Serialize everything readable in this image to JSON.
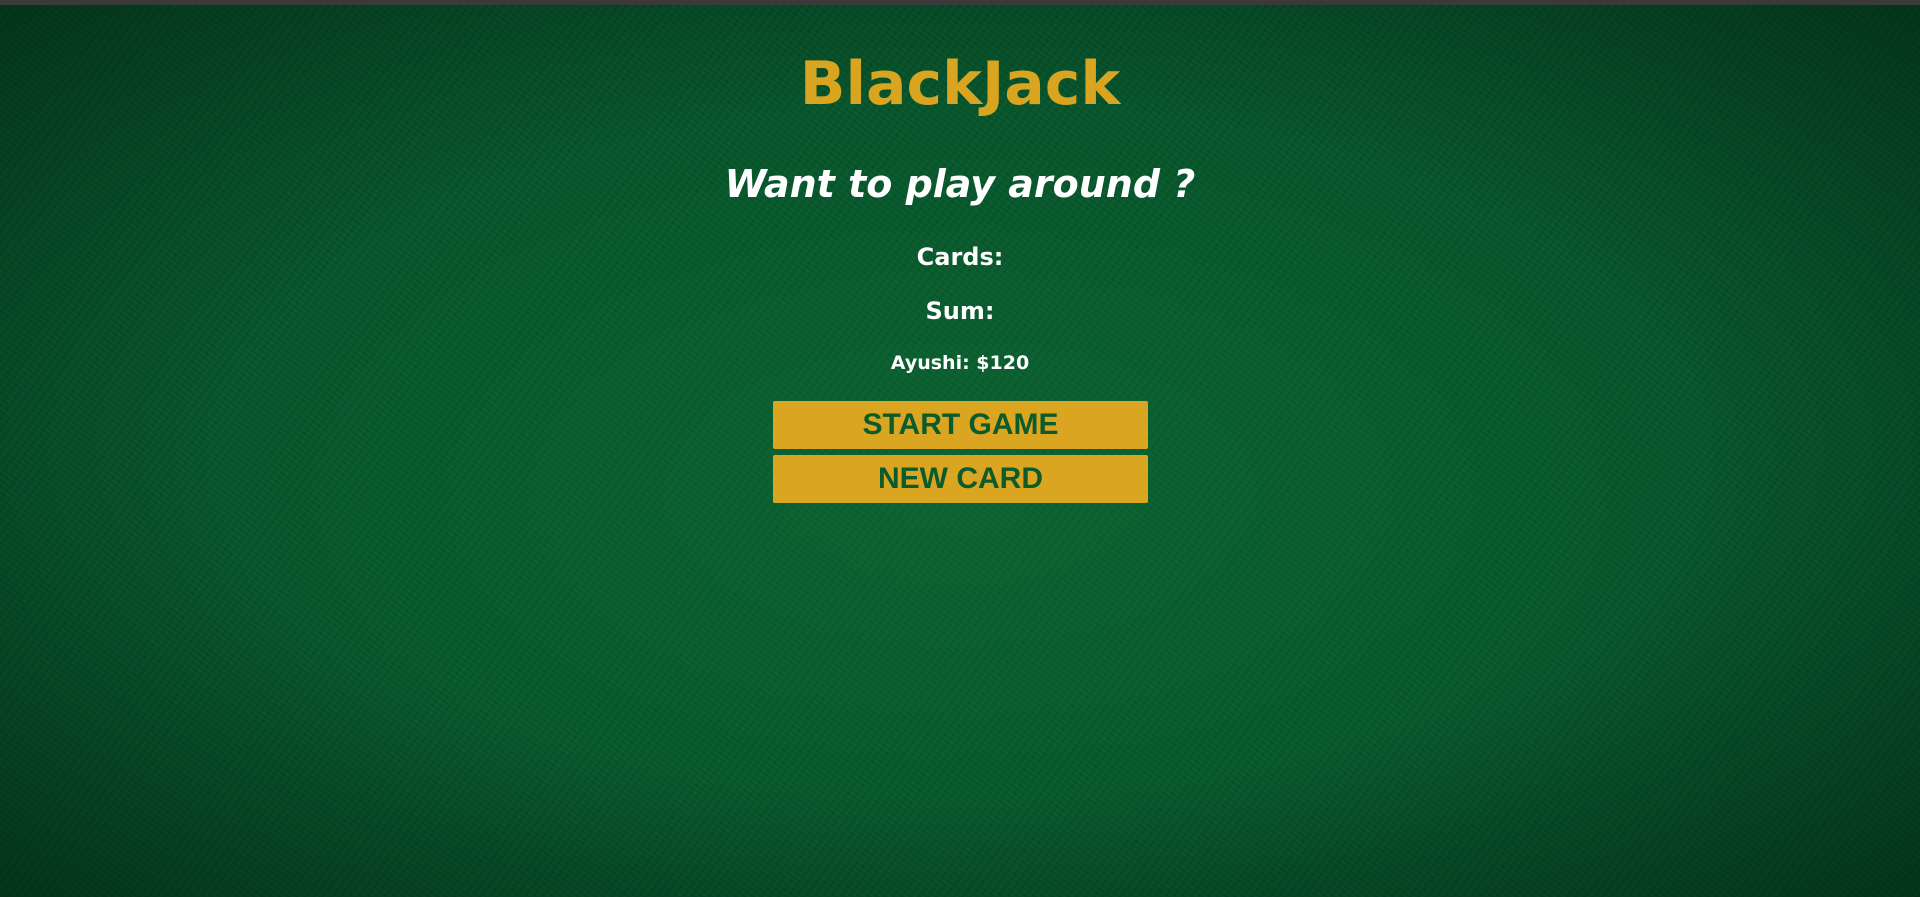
{
  "page": {
    "title": "BlackJack",
    "message": "Want to play around ?",
    "cards_label": "Cards:",
    "sum_label": "Sum:",
    "player_info": "Ayushi: $120"
  },
  "buttons": {
    "start_label": "START GAME",
    "new_card_label": "NEW CARD"
  },
  "colors": {
    "background": "#05532a",
    "title": "#d9a520",
    "text": "#ffffff",
    "button_bg": "#daa520",
    "button_text": "#0d5a2a"
  }
}
